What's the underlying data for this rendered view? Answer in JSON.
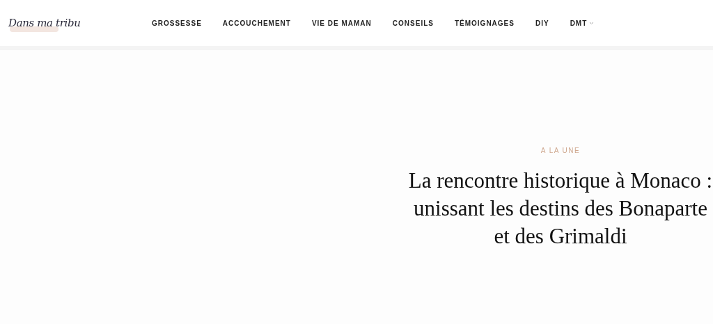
{
  "logo": {
    "text": "Dans ma tribu"
  },
  "nav": [
    {
      "label": "GROSSESSE",
      "dropdown": false
    },
    {
      "label": "ACCOUCHEMENT",
      "dropdown": false
    },
    {
      "label": "VIE DE MAMAN",
      "dropdown": false
    },
    {
      "label": "CONSEILS",
      "dropdown": false
    },
    {
      "label": "TÉMOIGNAGES",
      "dropdown": false
    },
    {
      "label": "DIY",
      "dropdown": false
    },
    {
      "label": "DMT",
      "dropdown": true
    }
  ],
  "featured": {
    "category": "A LA UNE",
    "title": "La rencontre historique à Monaco : unissant les destins des Bonaparte et des Grimaldi"
  }
}
